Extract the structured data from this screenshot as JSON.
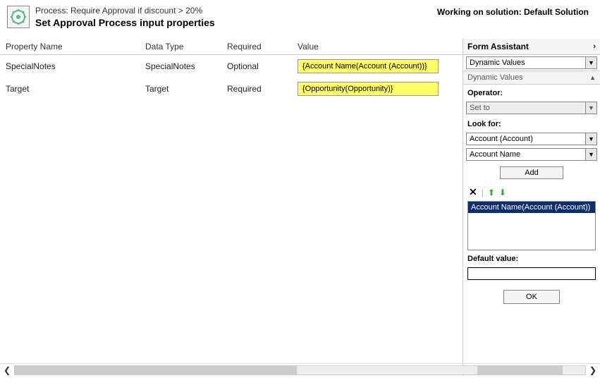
{
  "header": {
    "process_prefix": "Process: ",
    "process_name": "Require Approval if discount > 20%",
    "subtitle": "Set Approval Process input properties",
    "working_prefix": "Working on solution: ",
    "solution_name": "Default Solution"
  },
  "columns": {
    "prop": "Property Name",
    "type": "Data Type",
    "req": "Required",
    "val": "Value"
  },
  "rows": [
    {
      "prop": "SpecialNotes",
      "type": "SpecialNotes",
      "req": "Optional",
      "val": "{Account Name(Account (Account))}"
    },
    {
      "prop": "Target",
      "type": "Target",
      "req": "Required",
      "val": "{Opportunity(Opportunity)}"
    }
  ],
  "assistant": {
    "title": "Form Assistant",
    "dynamic_values_label": "Dynamic Values",
    "operator_label": "Operator:",
    "operator_value": "Set to",
    "lookfor_label": "Look for:",
    "lookfor_entity": "Account (Account)",
    "lookfor_attr": "Account Name",
    "add_label": "Add",
    "list_item": "Account Name(Account (Account))",
    "default_label": "Default value:",
    "ok_label": "OK"
  }
}
